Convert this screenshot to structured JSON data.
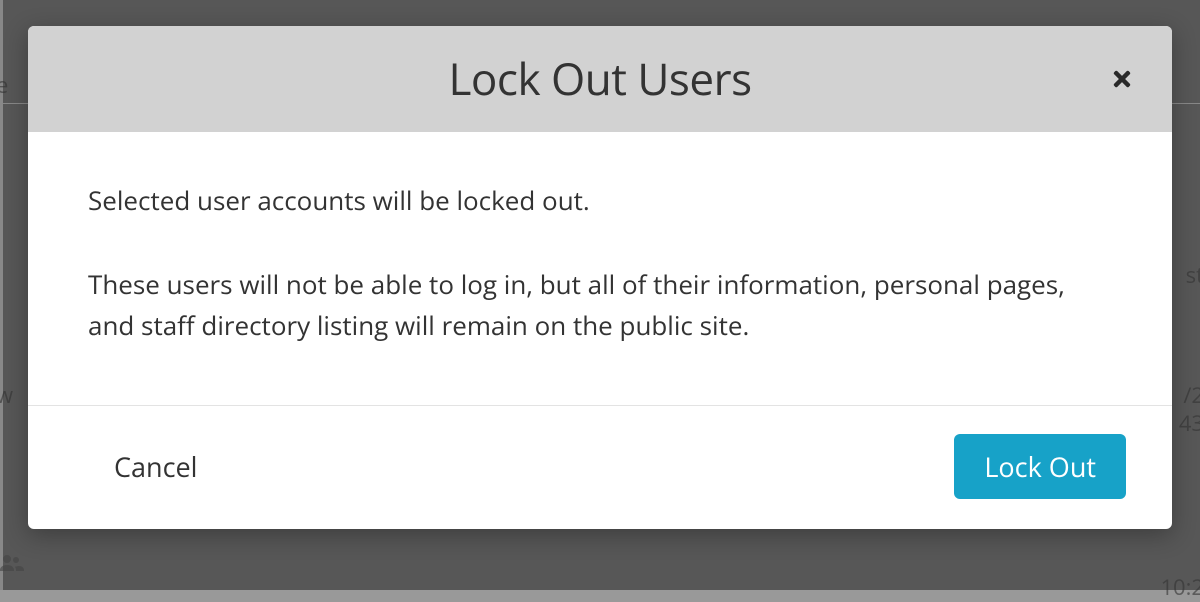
{
  "modal": {
    "title": "Lock Out Users",
    "body": {
      "p1": "Selected user accounts will be locked out.",
      "p2": "These users will not be able to log in, but all of their information, personal pages, and staff directory listing will remain on the public site."
    },
    "footer": {
      "cancel_label": "Cancel",
      "confirm_label": "Lock Out"
    }
  },
  "background": {
    "frag_e": "e",
    "frag_st": "st",
    "frag_slash2": "/2",
    "frag_43": "43",
    "frag_w": "w",
    "frag_102": "10:2"
  }
}
